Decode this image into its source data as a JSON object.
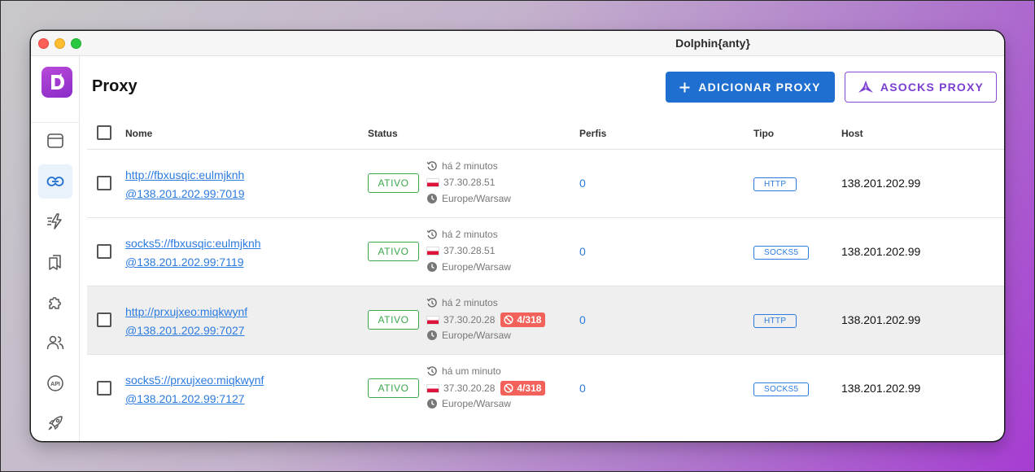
{
  "app": {
    "title": "Dolphin{anty}"
  },
  "page": {
    "title": "Proxy"
  },
  "toolbar": {
    "add_label": "ADICIONAR PROXY",
    "asocks_label": "ASOCKS PROXY"
  },
  "table": {
    "headers": {
      "name": "Nome",
      "status": "Status",
      "profiles": "Perfis",
      "type": "Tipo",
      "host": "Host"
    },
    "rows": [
      {
        "name_line1": "http://fbxusqic:eulmjknh",
        "name_line2": "@138.201.202.99:7019",
        "status": "ATIVO",
        "checked": "há 2 minutos",
        "ip": "37.30.28.51",
        "blocked": "",
        "timezone": "Europe/Warsaw",
        "profiles": "0",
        "type": "HTTP",
        "host": "138.201.202.99"
      },
      {
        "name_line1": "socks5://fbxusqic:eulmjknh",
        "name_line2": "@138.201.202.99:7119",
        "status": "ATIVO",
        "checked": "há 2 minutos",
        "ip": "37.30.28.51",
        "blocked": "",
        "timezone": "Europe/Warsaw",
        "profiles": "0",
        "type": "SOCKS5",
        "host": "138.201.202.99"
      },
      {
        "name_line1": "http://prxujxeo:miqkwynf",
        "name_line2": "@138.201.202.99:7027",
        "status": "ATIVO",
        "checked": "há 2 minutos",
        "ip": "37.30.20.28",
        "blocked": "4/318",
        "timezone": "Europe/Warsaw",
        "profiles": "0",
        "type": "HTTP",
        "host": "138.201.202.99"
      },
      {
        "name_line1": "socks5://prxujxeo:miqkwynf",
        "name_line2": "@138.201.202.99:7127",
        "status": "ATIVO",
        "checked": "há um minuto",
        "ip": "37.30.20.28",
        "blocked": "4/318",
        "timezone": "Europe/Warsaw",
        "profiles": "0",
        "type": "SOCKS5",
        "host": "138.201.202.99"
      }
    ]
  },
  "sidebar": {
    "items": [
      {
        "icon": "browser-window-icon",
        "active": false
      },
      {
        "icon": "link-icon",
        "active": true
      },
      {
        "icon": "automation-icon",
        "active": false
      },
      {
        "icon": "bookmarks-icon",
        "active": false
      },
      {
        "icon": "puzzle-extension-icon",
        "active": false
      },
      {
        "icon": "users-icon",
        "active": false
      },
      {
        "icon": "api-icon",
        "active": false,
        "label": "API"
      },
      {
        "icon": "rocket-icon",
        "active": false
      }
    ]
  },
  "colors": {
    "accent": "#1e6fd0",
    "link": "#2c7be0",
    "ok": "#3aa74a",
    "danger": "#f2625a",
    "brand": "#9b3ad2"
  }
}
